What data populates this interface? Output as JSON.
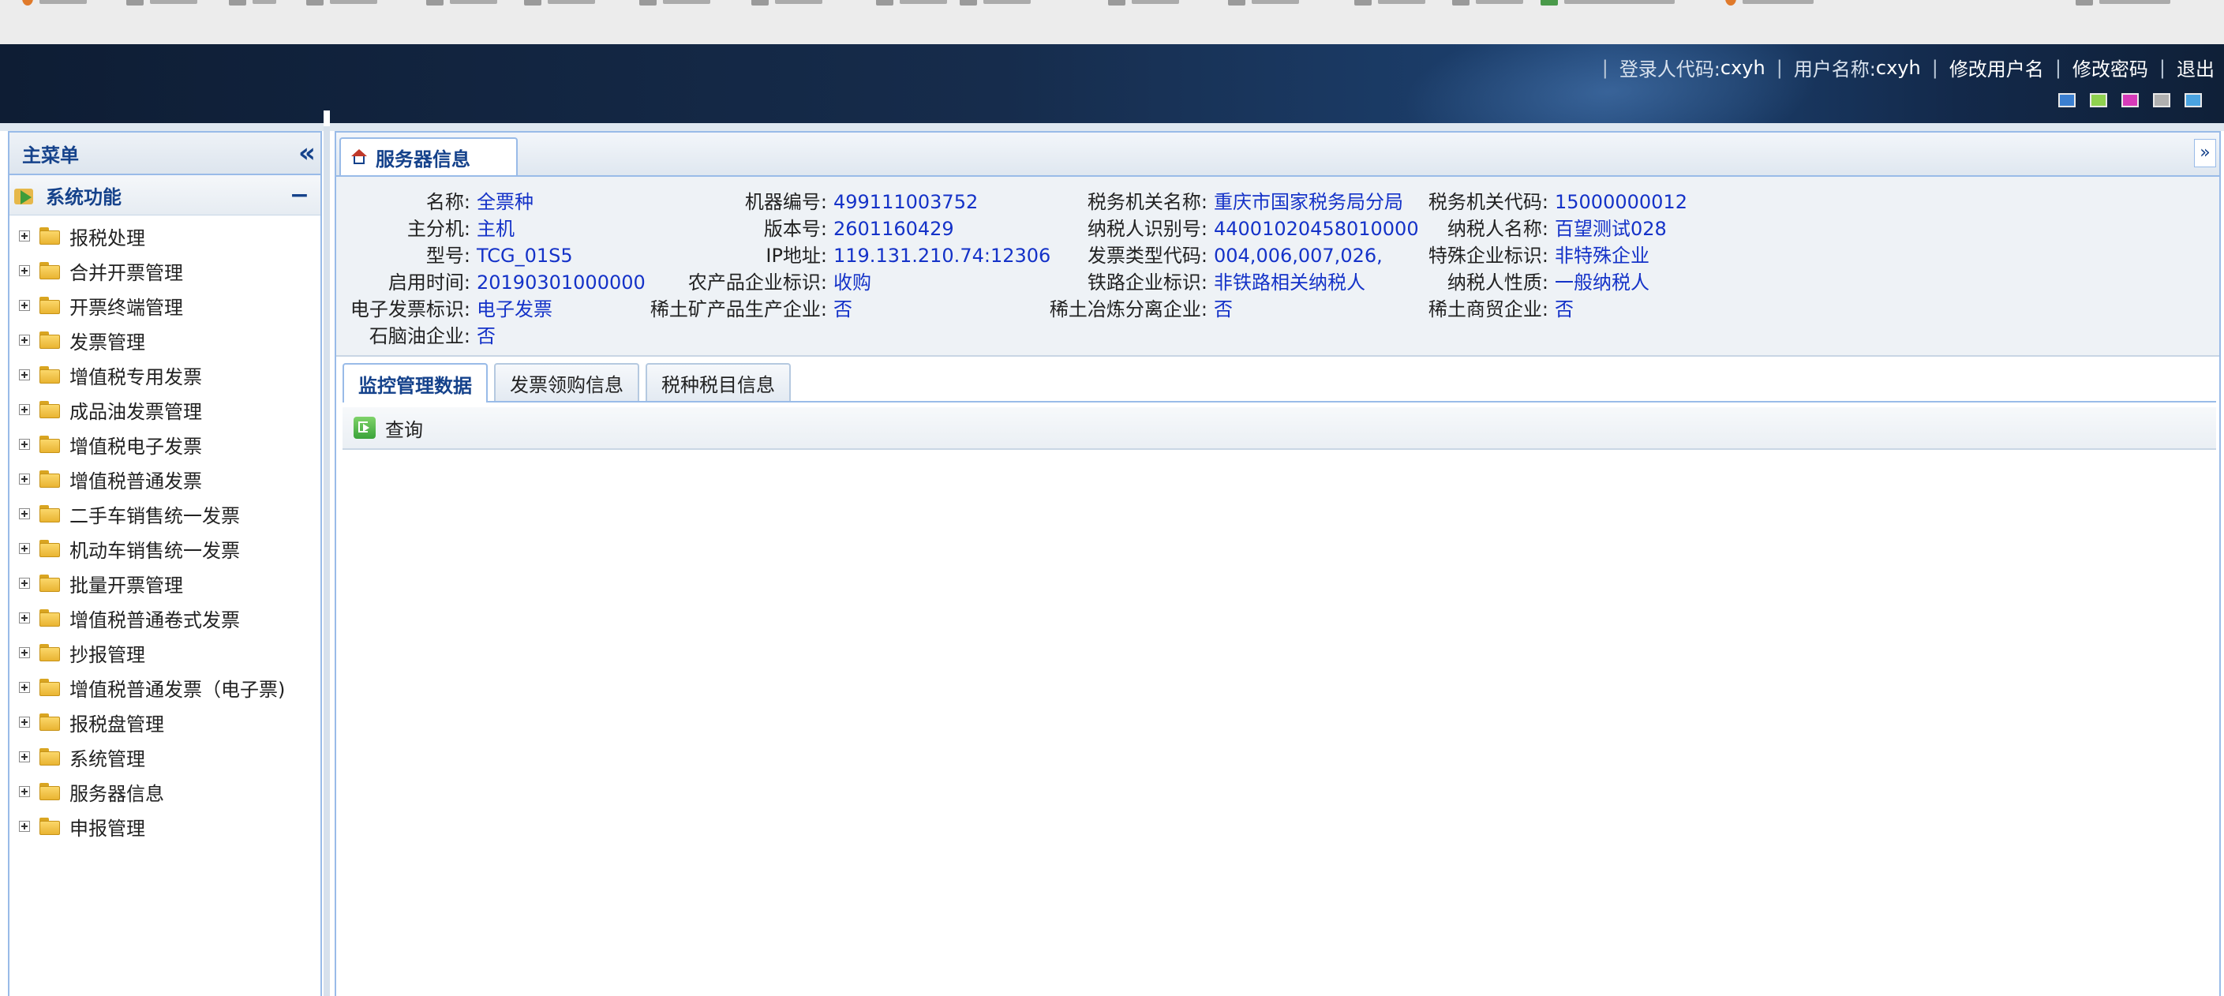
{
  "header": {
    "login_code_label": "登录人代码:",
    "login_code_value": "cxyh",
    "user_name_label": "用户名称:",
    "user_name_value": "cxyh",
    "change_username": "修改用户名",
    "change_password": "修改密码",
    "logout": "退出",
    "skin_colors": [
      "#3b7fd0",
      "#8fd14f",
      "#d63ab9",
      "#b0b0b0",
      "#4aa3e0"
    ]
  },
  "sidebar": {
    "title": "主菜单",
    "section": "系统功能",
    "items": [
      {
        "label": "报税处理"
      },
      {
        "label": "合并开票管理"
      },
      {
        "label": "开票终端管理"
      },
      {
        "label": "发票管理"
      },
      {
        "label": "增值税专用发票"
      },
      {
        "label": "成品油发票管理"
      },
      {
        "label": "增值税电子发票"
      },
      {
        "label": "增值税普通发票"
      },
      {
        "label": "二手车销售统一发票"
      },
      {
        "label": "机动车销售统一发票"
      },
      {
        "label": "批量开票管理"
      },
      {
        "label": "增值税普通卷式发票"
      },
      {
        "label": "抄报管理"
      },
      {
        "label": "增值税普通发票（电子票)"
      },
      {
        "label": "报税盘管理"
      },
      {
        "label": "系统管理"
      },
      {
        "label": "服务器信息"
      },
      {
        "label": "申报管理"
      }
    ]
  },
  "main": {
    "tab_label": "服务器信息",
    "info": {
      "name": {
        "k": "名称:",
        "v": "全票种"
      },
      "host": {
        "k": "主分机:",
        "v": "主机"
      },
      "model": {
        "k": "型号:",
        "v": "TCG_01S5"
      },
      "enable_time": {
        "k": "启用时间:",
        "v": "20190301000000"
      },
      "e_invoice_flag": {
        "k": "电子发票标识:",
        "v": "电子发票"
      },
      "petro_enterprise": {
        "k": "石脑油企业:",
        "v": "否"
      },
      "machine_no": {
        "k": "机器编号:",
        "v": "499111003752"
      },
      "version": {
        "k": "版本号:",
        "v": "2601160429"
      },
      "ip": {
        "k": "IP地址:",
        "v": "119.131.210.74:12306"
      },
      "agri_flag": {
        "k": "农产品企业标识:",
        "v": "收购"
      },
      "rare_mineral": {
        "k": "稀土矿产品生产企业:",
        "v": "否"
      },
      "tax_office_name": {
        "k": "税务机关名称:",
        "v": "重庆市国家税务局分局"
      },
      "taxpayer_id": {
        "k": "纳税人识别号:",
        "v": "44001020458010000"
      },
      "invoice_type_code": {
        "k": "发票类型代码:",
        "v": "004,006,007,026,"
      },
      "railway_flag": {
        "k": "铁路企业标识:",
        "v": "非铁路相关纳税人"
      },
      "rare_smelt": {
        "k": "稀土冶炼分离企业:",
        "v": "否"
      },
      "tax_office_code": {
        "k": "税务机关代码:",
        "v": "15000000012"
      },
      "taxpayer_name": {
        "k": "纳税人名称:",
        "v": "百望测试028"
      },
      "special_flag": {
        "k": "特殊企业标识:",
        "v": "非特殊企业"
      },
      "taxpayer_nature": {
        "k": "纳税人性质:",
        "v": "一般纳税人"
      },
      "rare_trade": {
        "k": "稀土商贸企业:",
        "v": "否"
      }
    },
    "subtabs": [
      "监控管理数据",
      "发票领购信息",
      "税种税目信息"
    ],
    "query_label": "查询"
  }
}
